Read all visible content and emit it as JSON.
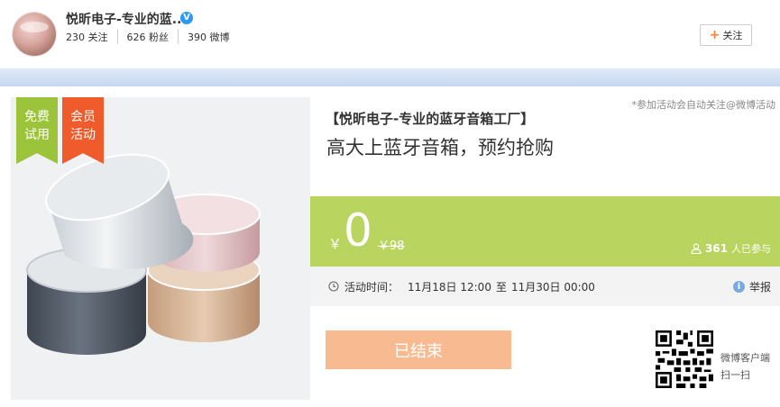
{
  "header": {
    "shop_name": "悦昕电子-专业的蓝...",
    "verified_mark": "V",
    "stats": [
      "230 关注",
      "626 粉丝",
      "390 微博"
    ],
    "follow_button": {
      "plus": "+",
      "label": "关注"
    }
  },
  "product": {
    "tags": [
      {
        "text": "免费试用",
        "line1": "免费",
        "line2": "试用",
        "color": "#9cc43a"
      },
      {
        "text": "会员活动",
        "line1": "会员",
        "line2": "活动",
        "color": "#ef5b2b"
      }
    ]
  },
  "info": {
    "notice": "*参加活动会自动关注@微博活动",
    "title_line1": "【悦昕电子-专业的蓝牙音箱工厂】",
    "title_line2": "高大上蓝牙音箱，预约抢购",
    "price": {
      "currency": "￥",
      "current": "0",
      "original": "￥98"
    },
    "participants": {
      "count": "361",
      "label": "人已参与"
    },
    "time": {
      "label": "活动时间：",
      "start": "11月18日 12:00",
      "separator": "至",
      "end": "11月30日 00:00"
    },
    "report_label": "举报",
    "status_button": "已结束",
    "qr_caption": {
      "line1": "微博客户端",
      "line2": "扫一扫"
    }
  },
  "colors": {
    "accent_green": "#b9d560",
    "ended_orange": "#f8ba90",
    "follow_plus": "#ff8140",
    "verified_blue": "#2a9af2"
  },
  "icons": [
    "verified-icon",
    "plus-icon",
    "person-icon",
    "clock-icon",
    "info-icon",
    "qr-code-icon"
  ]
}
